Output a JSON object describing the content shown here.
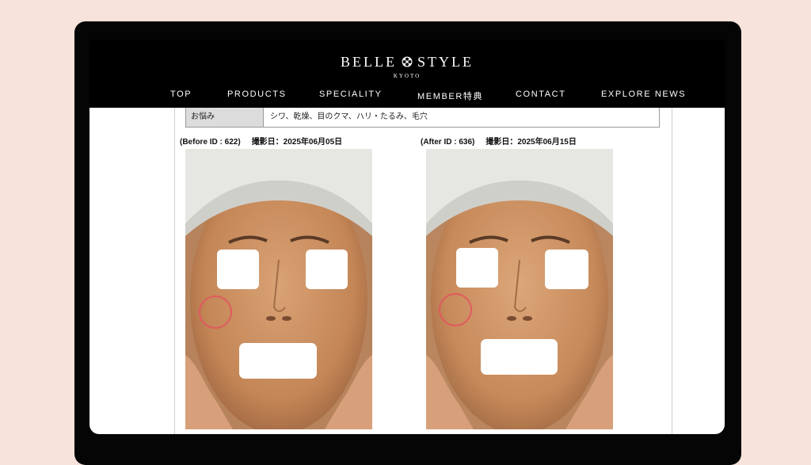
{
  "brand": {
    "name_left": "BELLE",
    "name_right": "STYLE",
    "location": "KYOTO"
  },
  "nav": {
    "items": [
      "TOP",
      "PRODUCTS",
      "SPECIALITY",
      "MEMBER特典",
      "CONTACT",
      "EXPLORE NEWS"
    ]
  },
  "concerns": {
    "label": "お悩み",
    "value": "シワ、乾燥、目のクマ、ハリ・たるみ、毛穴"
  },
  "before": {
    "id_text": "(Before ID : 622)",
    "date_text": "撮影日：2025年06月05日"
  },
  "after": {
    "id_text": "(After ID : 636)",
    "date_text": "撮影日：2025年06月15日"
  },
  "colors": {
    "page_bg": "#f7e3dc",
    "frame": "#050505",
    "marker_circle": "#e05a5f",
    "skin": "#c98f63",
    "towel": "#e6e6e2"
  }
}
